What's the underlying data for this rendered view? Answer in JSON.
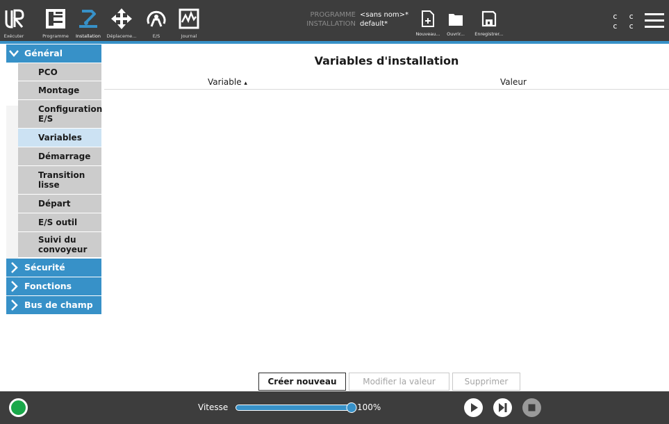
{
  "header": {
    "nav": [
      {
        "id": "run",
        "label": "Exécuter",
        "icon": "ur-logo-icon"
      },
      {
        "id": "program",
        "label": "Programme",
        "icon": "program-tree-icon"
      },
      {
        "id": "installation",
        "label": "Installation",
        "icon": "installation-robot-icon",
        "active": true
      },
      {
        "id": "move",
        "label": "Déplaceme...",
        "icon": "move-arrows-icon"
      },
      {
        "id": "io",
        "label": "E/S",
        "icon": "io-icon"
      },
      {
        "id": "log",
        "label": "Journal",
        "icon": "log-chart-icon"
      }
    ],
    "program_key": "PROGRAMME",
    "program_value": "<sans nom>*",
    "installation_key": "INSTALLATION",
    "installation_value": "default*",
    "file_buttons": [
      {
        "id": "new",
        "label": "Nouveau...",
        "icon": "new-file-icon"
      },
      {
        "id": "open",
        "label": "Ouvrir...",
        "icon": "folder-icon"
      },
      {
        "id": "save",
        "label": "Enregistrer...",
        "icon": "save-icon"
      }
    ],
    "cc_line1": "c c",
    "cc_line2": "c c",
    "menu_icon": "hamburger-menu-icon"
  },
  "sidebar": {
    "sections": [
      {
        "label": "Général",
        "expanded": true
      },
      {
        "label": "Sécurité",
        "expanded": false
      },
      {
        "label": "Fonctions",
        "expanded": false
      },
      {
        "label": "Bus de champ",
        "expanded": false
      }
    ],
    "general_items": [
      {
        "label": "PCO"
      },
      {
        "label": "Montage"
      },
      {
        "label": "Configuration E/S"
      },
      {
        "label": "Variables",
        "active": true
      },
      {
        "label": "Démarrage"
      },
      {
        "label": "Transition lisse"
      },
      {
        "label": "Départ"
      },
      {
        "label": "E/S outil"
      },
      {
        "label": "Suivi du convoyeur"
      }
    ]
  },
  "main": {
    "title": "Variables d'installation",
    "columns": {
      "variable": "Variable",
      "value": "Valeur"
    },
    "sort_indicator": "▴",
    "rows": [],
    "buttons": {
      "create": "Créer nouveau",
      "modify": "Modifier la valeur",
      "delete": "Supprimer"
    }
  },
  "footer": {
    "speed_label": "Vitesse",
    "speed_percent": 100,
    "speed_text": "100%",
    "power_status_color": "#1aa84a"
  },
  "colors": {
    "accent": "#3791c8",
    "header_bg": "#3d3d3d",
    "active_item": "#cce2f3",
    "inactive_item": "#cccccc"
  }
}
